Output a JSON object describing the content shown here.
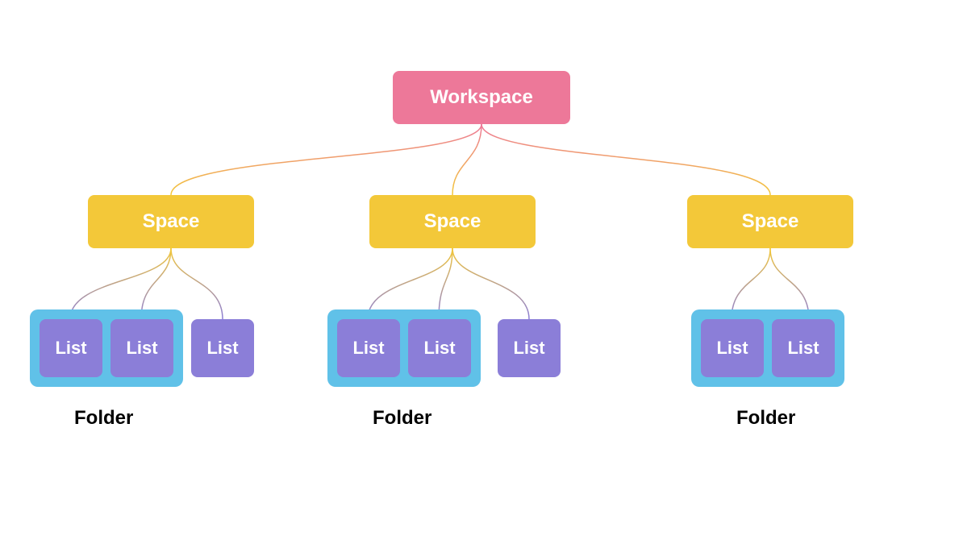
{
  "nodes": {
    "workspace": "Workspace",
    "space": "Space",
    "list": "List",
    "folder": "Folder"
  },
  "colors": {
    "workspace_bg": "#ed7899",
    "space_bg": "#f3c839",
    "folder_bg": "#60c1e8",
    "list_bg": "#8b7ed8",
    "text_light": "#ffffff",
    "text_dark": "#000000"
  },
  "structure": {
    "type": "hierarchy",
    "root": "Workspace",
    "children": [
      {
        "type": "Space",
        "children": [
          {
            "type": "Folder",
            "lists": [
              "List",
              "List"
            ]
          },
          {
            "type": "List"
          }
        ]
      },
      {
        "type": "Space",
        "children": [
          {
            "type": "Folder",
            "lists": [
              "List",
              "List"
            ]
          },
          {
            "type": "List"
          }
        ]
      },
      {
        "type": "Space",
        "children": [
          {
            "type": "Folder",
            "lists": [
              "List",
              "List"
            ]
          }
        ]
      }
    ]
  }
}
